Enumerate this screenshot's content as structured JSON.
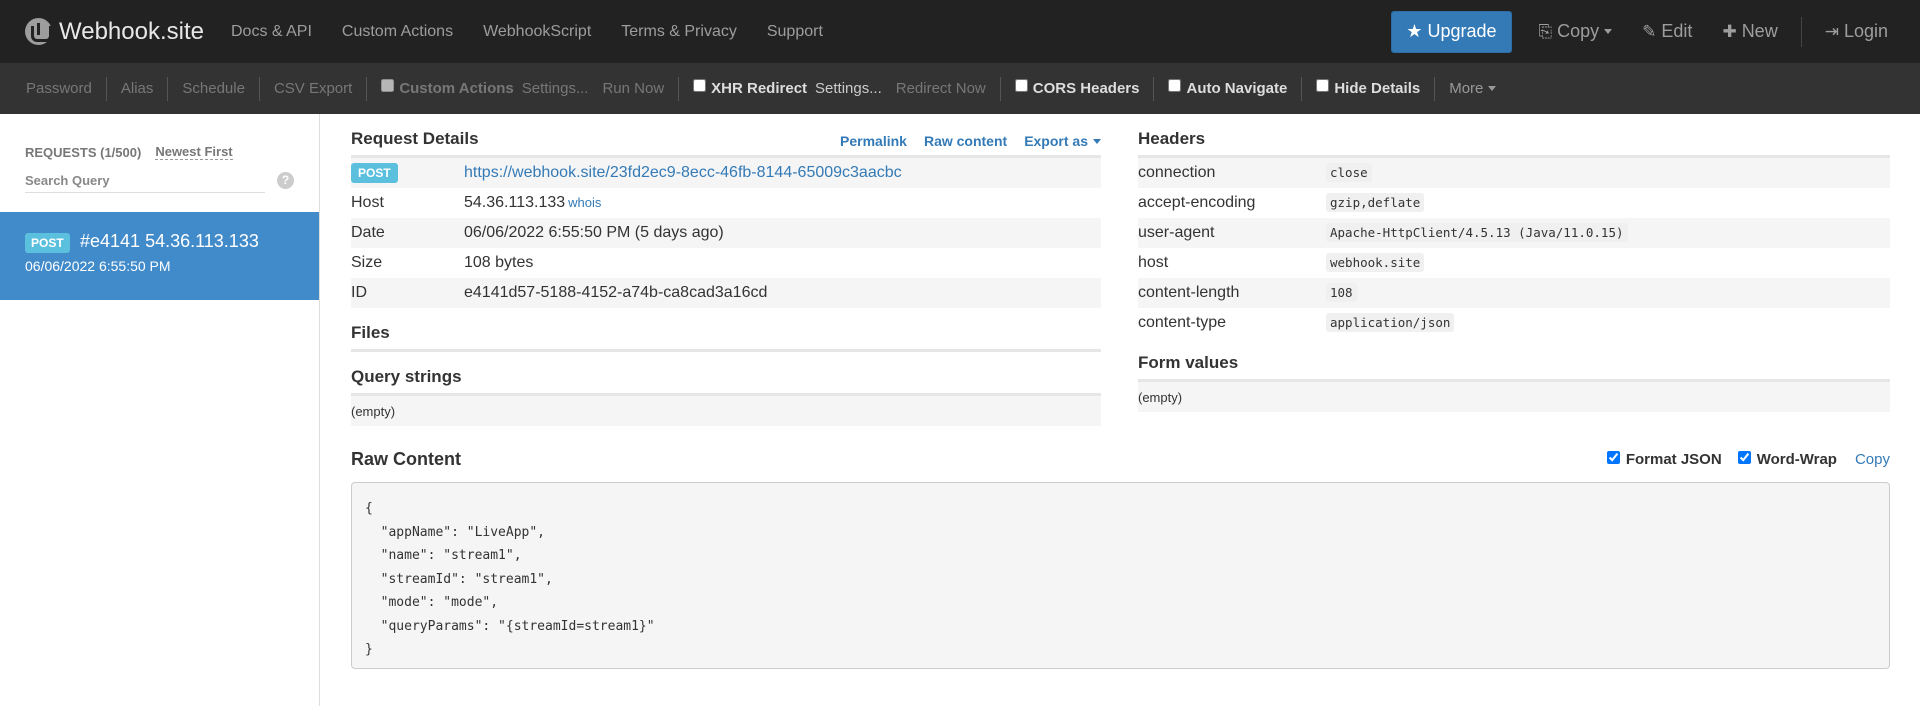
{
  "navbar": {
    "brand": "Webhook.site",
    "links": [
      "Docs & API",
      "Custom Actions",
      "WebhookScript",
      "Terms & Privacy",
      "Support"
    ],
    "upgrade": "Upgrade",
    "copy": "Copy",
    "edit": "Edit",
    "new": "New",
    "login": "Login"
  },
  "toolbar": {
    "password": "Password",
    "alias": "Alias",
    "schedule": "Schedule",
    "csv_export": "CSV Export",
    "custom_actions": "Custom Actions",
    "custom_actions_settings": "Settings...",
    "run_now": "Run Now",
    "xhr_redirect": "XHR Redirect",
    "xhr_settings": "Settings...",
    "redirect_now": "Redirect Now",
    "cors_headers": "CORS Headers",
    "auto_navigate": "Auto Navigate",
    "hide_details": "Hide Details",
    "more": "More"
  },
  "sidebar": {
    "requests_count": "REQUESTS (1/500)",
    "sort": "Newest First",
    "search_placeholder": "Search Query",
    "help": "?",
    "request": {
      "method": "POST",
      "id_ip": "#e4141 54.36.113.133",
      "date": "06/06/2022 6:55:50 PM"
    }
  },
  "request_details": {
    "title": "Request Details",
    "permalink": "Permalink",
    "raw_content": "Raw content",
    "export_as": "Export as",
    "method": "POST",
    "url": "https://webhook.site/23fd2ec9-8ecc-46fb-8144-65009c3aacbc",
    "host_label": "Host",
    "host": "54.36.113.133",
    "whois": "whois",
    "date_label": "Date",
    "date": "06/06/2022 6:55:50 PM (5 days ago)",
    "size_label": "Size",
    "size": "108 bytes",
    "id_label": "ID",
    "id": "e4141d57-5188-4152-a74b-ca8cad3a16cd"
  },
  "files": {
    "title": "Files"
  },
  "query_strings": {
    "title": "Query strings",
    "value": "(empty)"
  },
  "headers": {
    "title": "Headers",
    "rows": [
      {
        "key": "connection",
        "value": "close"
      },
      {
        "key": "accept-encoding",
        "value": "gzip,deflate"
      },
      {
        "key": "user-agent",
        "value": "Apache-HttpClient/4.5.13 (Java/11.0.15)"
      },
      {
        "key": "host",
        "value": "webhook.site"
      },
      {
        "key": "content-length",
        "value": "108"
      },
      {
        "key": "content-type",
        "value": "application/json"
      }
    ]
  },
  "form_values": {
    "title": "Form values",
    "value": "(empty)"
  },
  "raw": {
    "title": "Raw Content",
    "format_json": "Format JSON",
    "word_wrap": "Word-Wrap",
    "copy": "Copy",
    "body": "{\n  \"appName\": \"LiveApp\",\n  \"name\": \"stream1\",\n  \"streamId\": \"stream1\",\n  \"mode\": \"mode\",\n  \"queryParams\": \"{streamId=stream1}\"\n}"
  },
  "colors": {
    "navbar_bg": "#222222",
    "toolbar_bg": "#333333",
    "primary": "#337ab7",
    "selected_request": "#428bca",
    "method_badge": "#5bc0de"
  }
}
